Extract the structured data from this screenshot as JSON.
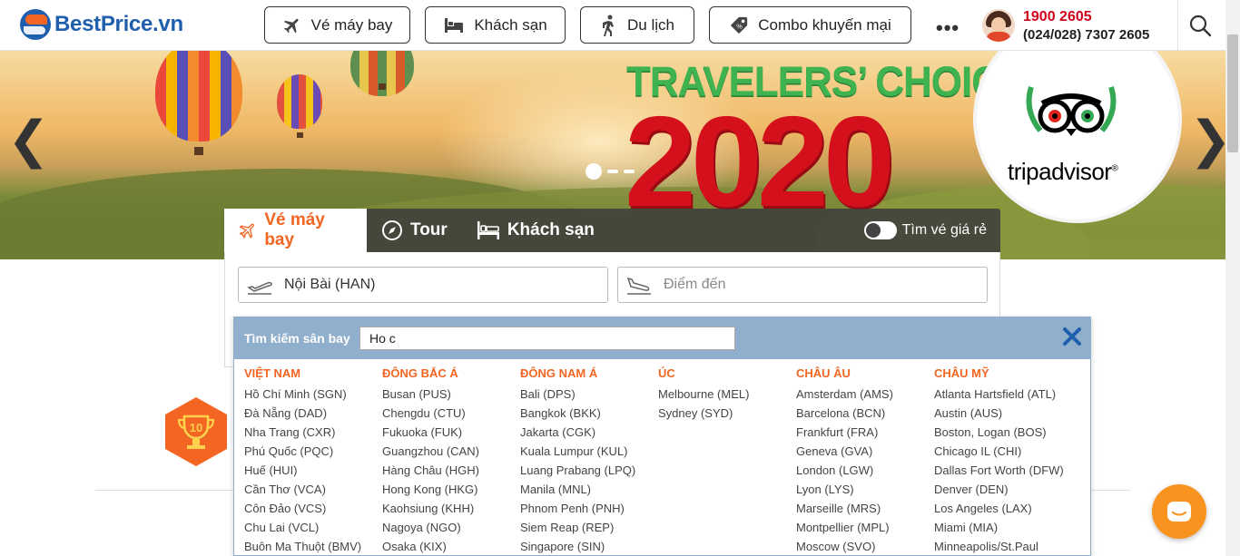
{
  "header": {
    "logo_text": "BestPrice",
    "logo_domain": ".vn",
    "nav": [
      {
        "label": "Vé máy bay",
        "icon": "airplane-icon"
      },
      {
        "label": "Khách sạn",
        "icon": "bed-icon"
      },
      {
        "label": "Du lịch",
        "icon": "hiker-icon"
      },
      {
        "label": "Combo khuyến mại",
        "icon": "tag-icon"
      }
    ],
    "more": "•••",
    "hotline": "1900 2605",
    "phone": "(024/028) 7307 2605"
  },
  "banner": {
    "award_title": "TRAVELERS’ CHOICE",
    "award_year": "2020",
    "brand": "tripadvisor",
    "brand_mark": "®",
    "prev": "❮",
    "next": "❯"
  },
  "search": {
    "tabs": [
      {
        "label": "Vé máy bay",
        "icon": "airplane-icon",
        "active": true
      },
      {
        "label": "Tour",
        "icon": "compass-icon",
        "active": false
      },
      {
        "label": "Khách sạn",
        "icon": "hotel-bed-icon",
        "active": false
      }
    ],
    "cheap_toggle_label": "Tìm vé giá rẻ",
    "origin_value": "Nội Bài (HAN)",
    "destination_placeholder": "Điểm đến"
  },
  "airport_picker": {
    "label": "Tìm kiếm sân bay",
    "query": "Ho c",
    "columns": [
      {
        "region": "VIỆT NAM",
        "airports": [
          "Hồ Chí Minh (SGN)",
          "Đà Nẵng (DAD)",
          "Nha Trang (CXR)",
          "Phú Quốc (PQC)",
          "Huế (HUI)",
          "Cần Thơ (VCA)",
          "Côn Đảo (VCS)",
          "Chu Lai (VCL)",
          "Buôn Ma Thuột (BMV)"
        ]
      },
      {
        "region": "ĐÔNG BẮC Á",
        "airports": [
          "Busan (PUS)",
          "Chengdu (CTU)",
          "Fukuoka (FUK)",
          "Guangzhou (CAN)",
          "Hàng Châu (HGH)",
          "Hong Kong (HKG)",
          "Kaohsiung (KHH)",
          "Nagoya (NGO)",
          "Osaka (KIX)"
        ]
      },
      {
        "region": "ĐÔNG NAM Á",
        "airports": [
          "Bali (DPS)",
          "Bangkok (BKK)",
          "Jakarta (CGK)",
          "Kuala Lumpur (KUL)",
          "Luang Prabang (LPQ)",
          "Manila (MNL)",
          "Phnom Penh (PNH)",
          "Siem Reap (REP)",
          "Singapore (SIN)"
        ]
      },
      {
        "region": "ÚC",
        "airports": [
          "Melbourne (MEL)",
          "Sydney (SYD)"
        ]
      },
      {
        "region": "CHÂU ÂU",
        "airports": [
          "Amsterdam (AMS)",
          "Barcelona (BCN)",
          "Frankfurt (FRA)",
          "Geneva (GVA)",
          "London (LGW)",
          "Lyon (LYS)",
          "Marseille (MRS)",
          "Montpellier (MPL)",
          "Moscow (SVO)"
        ]
      },
      {
        "region": "CHÂU MỸ",
        "airports": [
          "Atlanta Hartsfield (ATL)",
          "Austin (AUS)",
          "Boston, Logan (BOS)",
          "Chicago IL (CHI)",
          "Dallas Fort Worth (DFW)",
          "Denver (DEN)",
          "Los Angeles (LAX)",
          "Miami (MIA)",
          "Minneapolis/St.Paul"
        ]
      }
    ]
  },
  "colors": {
    "brand_orange": "#f26522",
    "brand_blue": "#1f5fae",
    "hotline_red": "#d0021b",
    "picker_header": "#8fafcc",
    "award_green": "#3fb34f",
    "award_red": "#d4101c"
  },
  "widgets": {
    "trophy_number": "10",
    "chat_icon": "chat-bubble-icon"
  }
}
